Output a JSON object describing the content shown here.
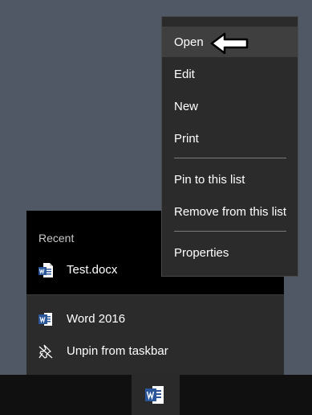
{
  "jumplist": {
    "recent_heading": "Recent",
    "recent_items": [
      {
        "label": "Test.docx",
        "icon": "word-document-icon"
      }
    ],
    "tasks": [
      {
        "label": "Word 2016",
        "icon": "word-app-icon"
      },
      {
        "label": "Unpin from taskbar",
        "icon": "unpin-icon"
      }
    ]
  },
  "context_menu": {
    "items": [
      "Open",
      "Edit",
      "New",
      "Print",
      "Pin to this list",
      "Remove from this list",
      "Properties"
    ],
    "highlighted": "Open"
  },
  "taskbar": {
    "pinned_app_icon": "word-app-icon"
  },
  "colors": {
    "desktop": "#4f5864",
    "menu_bg": "#2b2b2b",
    "highlight": "#3f3f3f",
    "word_blue": "#2b579a"
  }
}
